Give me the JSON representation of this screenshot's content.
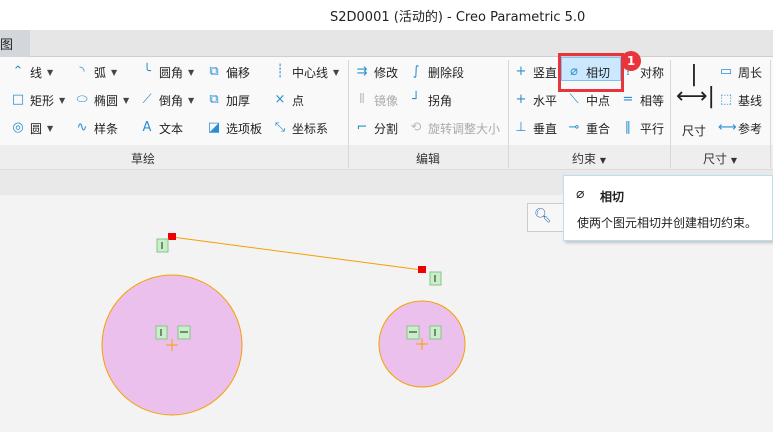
{
  "window": {
    "title": "S2D0001 (活动的) - Creo Parametric 5.0"
  },
  "tabs": [
    {
      "label": "图"
    }
  ],
  "groups": {
    "sketch": "草绘",
    "edit": "编辑",
    "constrain": "约束",
    "dimension": "尺寸"
  },
  "sketch_items": [
    {
      "label": "线",
      "icon": "line-icon",
      "glyph": "⌃",
      "dd": true
    },
    {
      "label": "矩形",
      "icon": "rectangle-icon",
      "glyph": "□",
      "dd": true
    },
    {
      "label": "圆",
      "icon": "circle-icon",
      "glyph": "◎",
      "dd": true
    },
    {
      "label": "弧",
      "icon": "arc-icon",
      "glyph": "◝",
      "dd": true
    },
    {
      "label": "椭圆",
      "icon": "ellipse-icon",
      "glyph": "⬭",
      "dd": true
    },
    {
      "label": "样条",
      "icon": "spline-icon",
      "glyph": "∿",
      "dd": false
    },
    {
      "label": "圆角",
      "icon": "fillet-icon",
      "glyph": "╰",
      "dd": true
    },
    {
      "label": "倒角",
      "icon": "chamfer-icon",
      "glyph": "⟋",
      "dd": true
    },
    {
      "label": "文本",
      "icon": "text-icon",
      "glyph": "A",
      "dd": false
    },
    {
      "label": "偏移",
      "icon": "offset-icon",
      "glyph": "⧉",
      "dd": false
    },
    {
      "label": "加厚",
      "icon": "thicken-icon",
      "glyph": "⧉",
      "dd": false
    },
    {
      "label": "选项板",
      "icon": "palette-icon",
      "glyph": "◪",
      "dd": false
    },
    {
      "label": "中心线",
      "icon": "centerline-icon",
      "glyph": "┊",
      "dd": true
    },
    {
      "label": "点",
      "icon": "point-icon",
      "glyph": "×",
      "dd": false
    },
    {
      "label": "坐标系",
      "icon": "coordinate-system-icon",
      "glyph": "⤡",
      "dd": false
    }
  ],
  "edit_items": [
    {
      "label": "修改",
      "icon": "modify-icon",
      "glyph": "⇉",
      "disabled": false
    },
    {
      "label": "镜像",
      "icon": "mirror-icon",
      "glyph": "⫴",
      "disabled": true
    },
    {
      "label": "分割",
      "icon": "divide-icon",
      "glyph": "⌐",
      "disabled": false
    },
    {
      "label": "删除段",
      "icon": "delete-segment-icon",
      "glyph": "∫",
      "disabled": false
    },
    {
      "label": "拐角",
      "icon": "corner-icon",
      "glyph": "┘",
      "disabled": false
    },
    {
      "label": "旋转调整大小",
      "icon": "rotate-resize-icon",
      "glyph": "⟲",
      "disabled": true
    }
  ],
  "constrain_items": [
    {
      "label": "竖直",
      "icon": "vertical-icon",
      "glyph": "+"
    },
    {
      "label": "水平",
      "icon": "horizontal-icon",
      "glyph": "+"
    },
    {
      "label": "垂直",
      "icon": "perpendicular-icon",
      "glyph": "⊥"
    },
    {
      "label": "相切",
      "icon": "tangent-icon",
      "glyph": "⌀"
    },
    {
      "label": "中点",
      "icon": "midpoint-icon",
      "glyph": "⟍"
    },
    {
      "label": "重合",
      "icon": "coincident-icon",
      "glyph": "⊸"
    },
    {
      "label": "对称",
      "icon": "symmetric-icon",
      "glyph": "⁞"
    },
    {
      "label": "相等",
      "icon": "equal-icon",
      "glyph": "="
    },
    {
      "label": "平行",
      "icon": "parallel-icon",
      "glyph": "∥"
    }
  ],
  "dimension_items": [
    {
      "label": "周长",
      "icon": "perimeter-icon",
      "glyph": "▭"
    },
    {
      "label": "基线",
      "icon": "baseline-icon",
      "glyph": "⬚"
    },
    {
      "label": "参考",
      "icon": "reference-icon",
      "glyph": "⟷"
    }
  ],
  "dimension_main": "尺寸",
  "callout": "1",
  "tooltip": {
    "title": "相切",
    "description": "使两个图元相切并创建相切约束。"
  },
  "colors": {
    "accent": "#2a8fd0",
    "highlight": "#e8343a",
    "sketch_line": "#f5a000",
    "circle_fill": "#ecc0ec",
    "constraint": "#c8f0c8"
  }
}
